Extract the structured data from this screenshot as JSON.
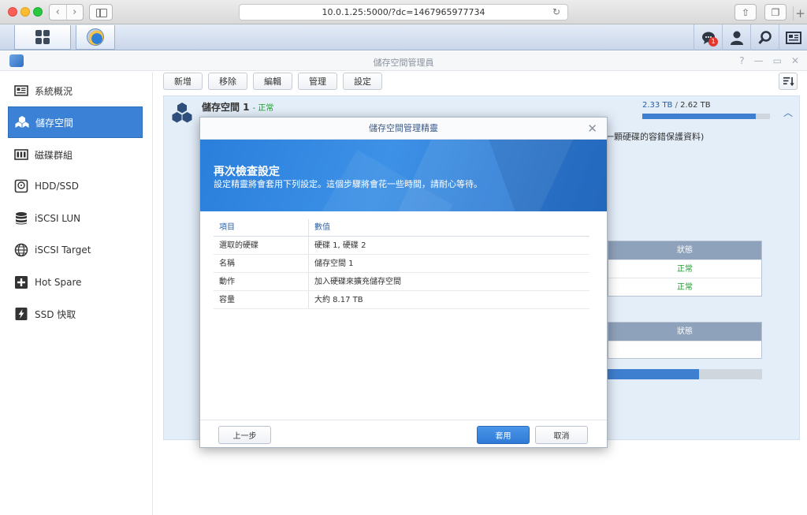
{
  "browser": {
    "url": "10.0.1.25:5000/?dc=1467965977734",
    "back_icon": "chevron-left-icon",
    "forward_icon": "chevron-right-icon"
  },
  "taskbar": {
    "notification_count": "1"
  },
  "window": {
    "title": "儲存空間管理員"
  },
  "sidebar": {
    "items": [
      {
        "label": "系統概況",
        "icon": "overview-icon",
        "active": false
      },
      {
        "label": "儲存空間",
        "icon": "volume-icon",
        "active": true
      },
      {
        "label": "磁碟群組",
        "icon": "disk-group-icon",
        "active": false
      },
      {
        "label": "HDD/SSD",
        "icon": "hdd-icon",
        "active": false
      },
      {
        "label": "iSCSI LUN",
        "icon": "database-icon",
        "active": false
      },
      {
        "label": "iSCSI Target",
        "icon": "globe-icon",
        "active": false
      },
      {
        "label": "Hot Spare",
        "icon": "plus-icon",
        "active": false
      },
      {
        "label": "SSD 快取",
        "icon": "bolt-icon",
        "active": false
      }
    ]
  },
  "toolbar": {
    "buttons": [
      "新增",
      "移除",
      "編輯",
      "管理",
      "設定"
    ]
  },
  "volume": {
    "name": "儲存空間 1",
    "status": "- 正常",
    "used": "2.33 TB",
    "separator": "/",
    "total": "2.62 TB",
    "usage_fraction": 0.89,
    "description_tail": "一顆硬碟的容錯保護資料)",
    "table1_header": "狀態",
    "table1_rows": [
      "正常",
      "正常"
    ],
    "table2_header": "狀態",
    "bar_fraction": 0.59
  },
  "wizard": {
    "title": "儲存空間管理精靈",
    "heading": "再次檢查設定",
    "subheading": "設定精靈將會套用下列設定。這個步驟將會花一些時間，請耐心等待。",
    "columns": [
      "項目",
      "數值"
    ],
    "rows": [
      [
        "選取的硬碟",
        "硬碟 1, 硬碟 2"
      ],
      [
        "名稱",
        "儲存空間 1"
      ],
      [
        "動作",
        "加入硬碟來擴充儲存空間"
      ],
      [
        "容量",
        "大約 8.17 TB"
      ]
    ],
    "back_label": "上一步",
    "apply_label": "套用",
    "cancel_label": "取消"
  },
  "colors": {
    "accent": "#3b82d6",
    "status_ok": "#1f9a2e",
    "banner": "#2a7fdc"
  }
}
